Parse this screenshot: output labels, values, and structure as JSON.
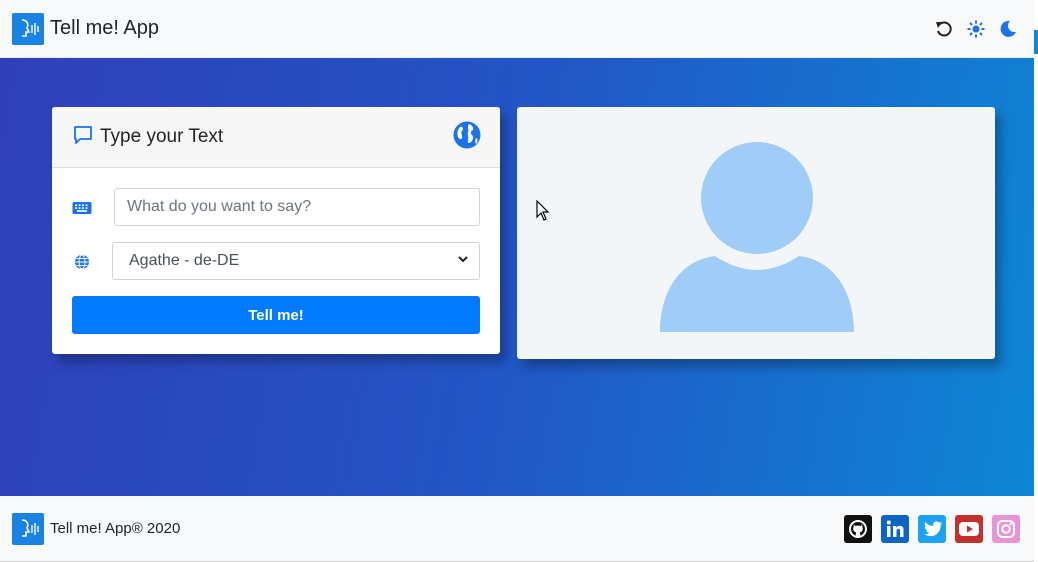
{
  "app": {
    "brand_name": "Tell me! App"
  },
  "nav": {
    "icons": [
      "reset-icon",
      "sun-icon",
      "moon-icon"
    ]
  },
  "form_card": {
    "title": "Type your Text",
    "text_placeholder": "What do you want to say?",
    "voice_selected": "Agathe - de-DE",
    "submit_label": "Tell me!"
  },
  "footer": {
    "copyright": "Tell me! App® 2020",
    "social": [
      "github-icon",
      "linkedin-icon",
      "twitter-icon",
      "youtube-icon",
      "instagram-icon"
    ]
  },
  "colors": {
    "primary": "#007bff",
    "gradient_start": "#2f3fb9",
    "gradient_end": "#0d86d5",
    "avatar": "#a0ccf8"
  }
}
